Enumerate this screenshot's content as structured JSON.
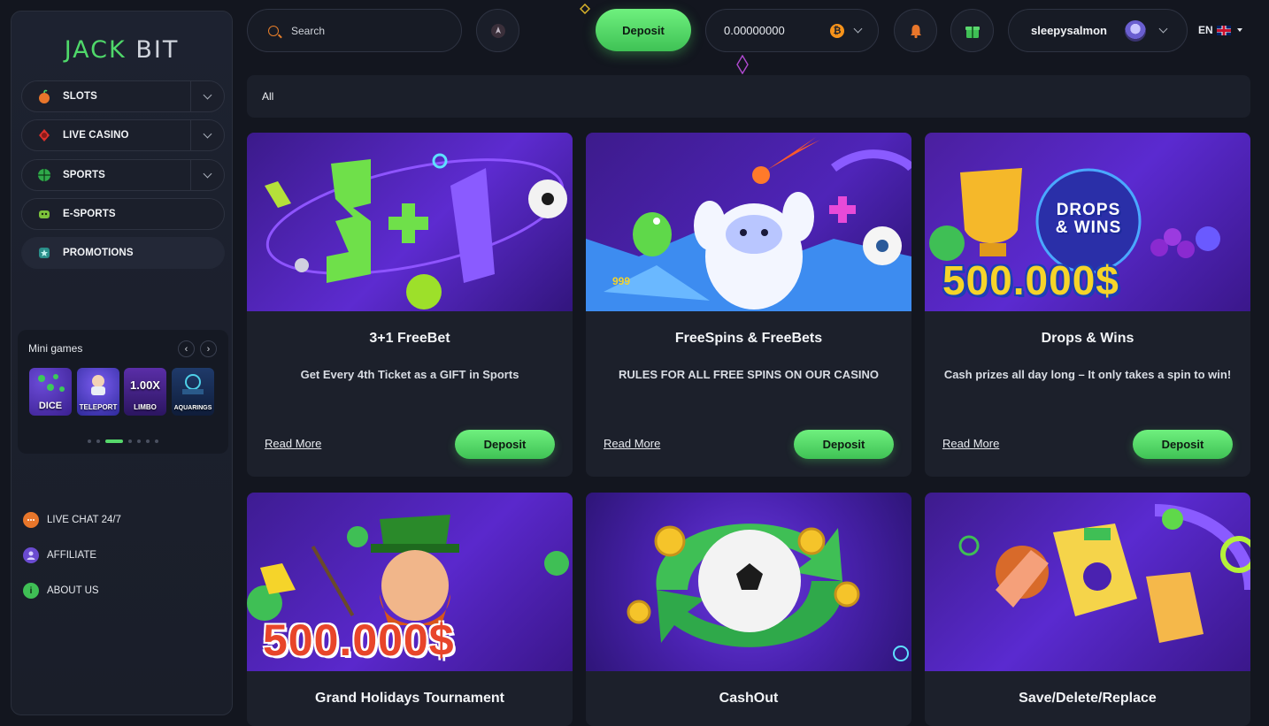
{
  "brand": {
    "logo_left": "JACK",
    "logo_right": "BIT"
  },
  "sidebar": {
    "menu": [
      {
        "label": "SLOTS",
        "icon": "slots-icon",
        "has_dropdown": true
      },
      {
        "label": "LIVE CASINO",
        "icon": "live-casino-icon",
        "has_dropdown": true
      },
      {
        "label": "SPORTS",
        "icon": "sports-icon",
        "has_dropdown": true
      },
      {
        "label": "E-SPORTS",
        "icon": "esports-icon",
        "has_dropdown": false
      },
      {
        "label": "PROMOTIONS",
        "icon": "promotions-icon",
        "has_dropdown": false,
        "active": true
      }
    ],
    "mini_games": {
      "title": "Mini games",
      "tiles": [
        {
          "label": "DICE"
        },
        {
          "label": "TELEPORT"
        },
        {
          "label": "LIMBO",
          "value": "1.00X"
        },
        {
          "label": "AQUARINGS"
        }
      ],
      "page_count": 7,
      "active_page": 2
    },
    "links": [
      {
        "label": "LIVE CHAT 24/7",
        "icon": "chat-icon"
      },
      {
        "label": "AFFILIATE",
        "icon": "affiliate-icon"
      },
      {
        "label": "ABOUT US",
        "icon": "info-icon"
      }
    ]
  },
  "header": {
    "search_placeholder": "Search",
    "deposit_label": "Deposit",
    "balance": "0.00000000",
    "currency_icon": "bitcoin-icon",
    "username": "sleepysalmon",
    "language": "EN"
  },
  "filter": {
    "selected": "All"
  },
  "promotions": [
    {
      "title": "3+1 FreeBet",
      "description": "Get Every 4th Ticket as a GIFT in Sports",
      "read_more": "Read More",
      "button": "Deposit"
    },
    {
      "title": "FreeSpins & FreeBets",
      "description": "RULES FOR ALL FREE SPINS ON OUR CASINO",
      "read_more": "Read More",
      "button": "Deposit"
    },
    {
      "title": "Drops & Wins",
      "description": "Cash prizes all day long – It only takes a spin to win!",
      "read_more": "Read More",
      "button": "Deposit",
      "banner_text": [
        "DROPS",
        "& WINS",
        "500.000$"
      ]
    },
    {
      "title": "Grand Holidays Tournament",
      "banner_text": [
        "500.000$"
      ]
    },
    {
      "title": "CashOut"
    },
    {
      "title": "Save/Delete/Replace"
    }
  ],
  "colors": {
    "accent": "#4fd86a",
    "background": "#13161f",
    "panel": "#1c202b",
    "orange": "#e67e2a"
  }
}
